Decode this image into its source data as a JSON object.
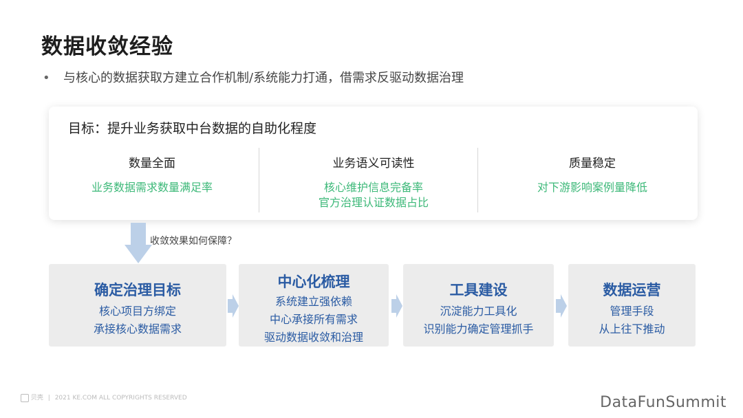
{
  "title": "数据收敛经验",
  "bullet": "与核心的数据获取方建立合作机制/系统能力打通，借需求反驱动数据治理",
  "goal": {
    "title": "目标：提升业务获取中台数据的自助化程度",
    "columns": [
      {
        "head": "数量全面",
        "lines": [
          "业务数据需求数量满足率"
        ]
      },
      {
        "head": "业务语义可读性",
        "lines": [
          "核心维护信息完备率",
          "官方治理认证数据占比"
        ]
      },
      {
        "head": "质量稳定",
        "lines": [
          "对下游影响案例量降低"
        ]
      }
    ]
  },
  "question": "收敛效果如何保障？",
  "steps": [
    {
      "head": "确定治理目标",
      "lines": [
        "核心项目方绑定",
        "承接核心数据需求"
      ]
    },
    {
      "head": "中心化梳理",
      "lines": [
        "系统建立强依赖",
        "中心承接所有需求",
        "驱动数据收敛和治理"
      ]
    },
    {
      "head": "工具建设",
      "lines": [
        "沉淀能力工具化",
        "识别能力确定管理抓手"
      ]
    },
    {
      "head": "数据运营",
      "lines": [
        "管理手段",
        "从上往下推动"
      ]
    }
  ],
  "footer": {
    "logo_text": "贝壳",
    "copyright": "2021 KE.COM ALL COPYRIGHTS  RESERVED"
  },
  "brand": "DataFunSummit",
  "colors": {
    "accent_green": "#3cb878",
    "step_blue": "#2a5ba3",
    "arrow": "#bcd0e8"
  }
}
